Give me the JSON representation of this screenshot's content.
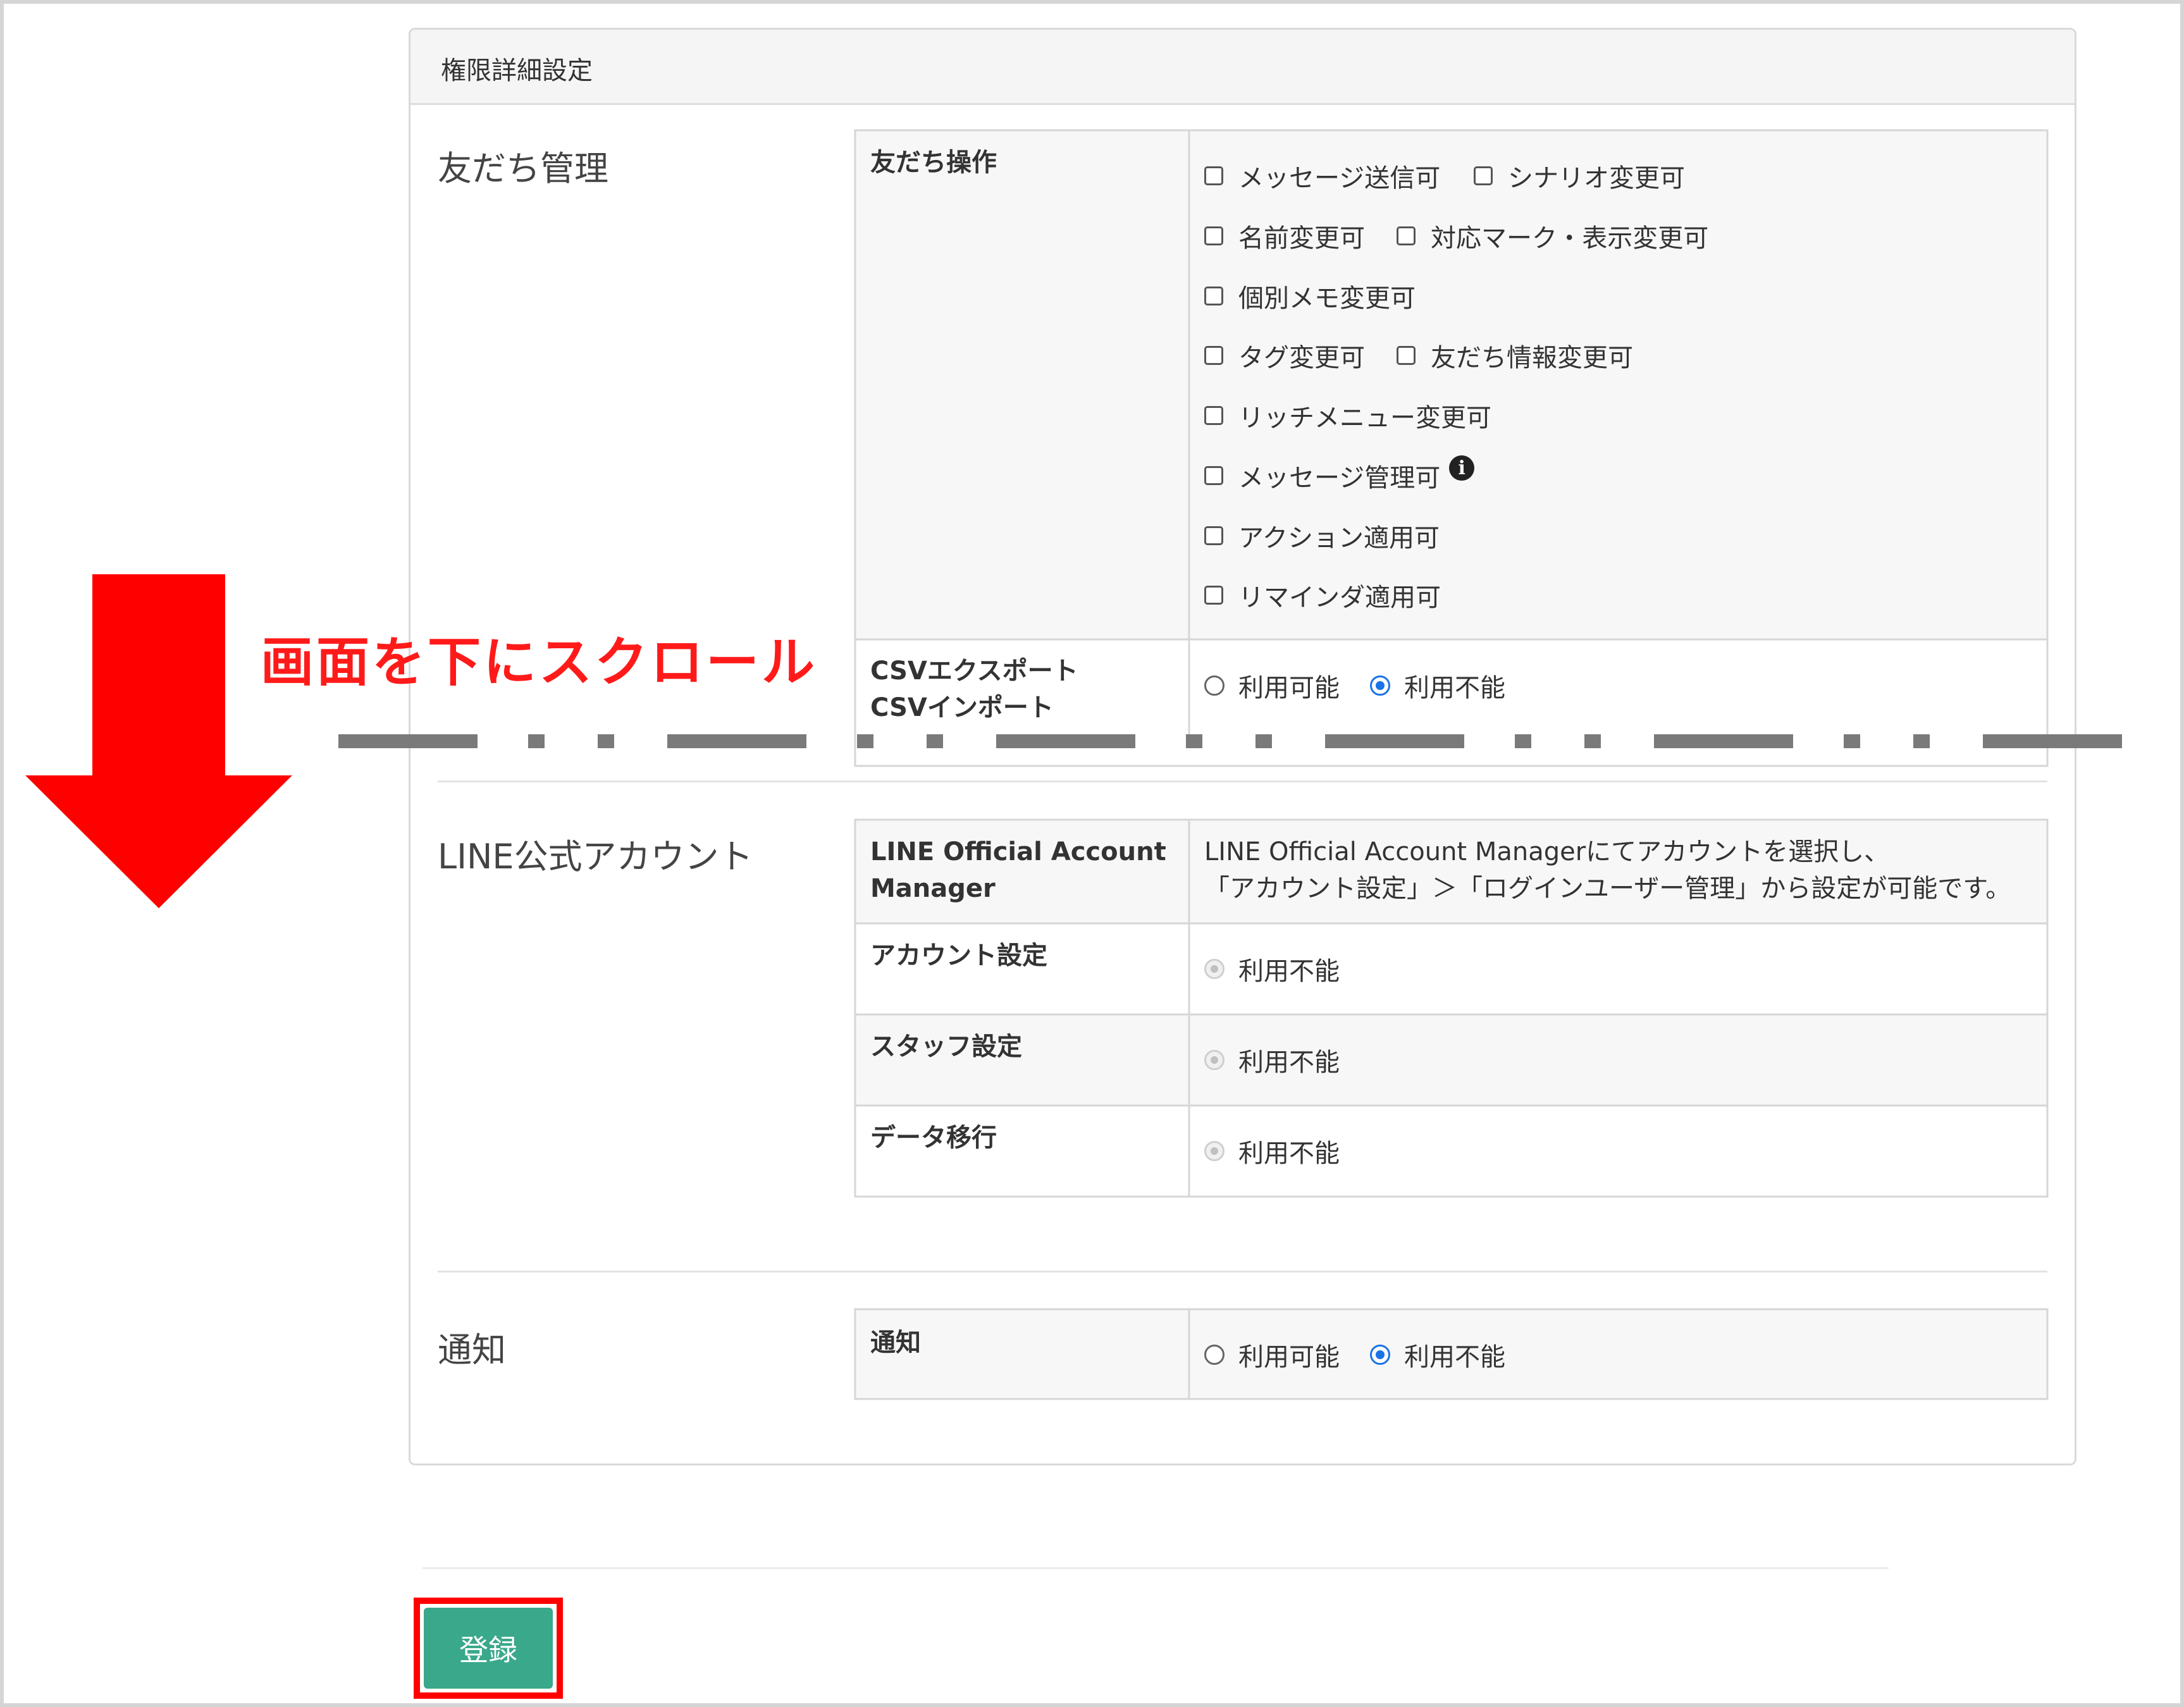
{
  "panel": {
    "title": "権限詳細設定"
  },
  "sections": {
    "friends": {
      "title": "友だち管理",
      "friend_ops": {
        "label": "友だち操作",
        "options": [
          "メッセージ送信可",
          "シナリオ変更可",
          "名前変更可",
          "対応マーク・表示変更可",
          "個別メモ変更可",
          "タグ変更可",
          "友だち情報変更可",
          "リッチメニュー変更可",
          "メッセージ管理可",
          "アクション適用可",
          "リマインダ適用可"
        ],
        "info_icon": "info-circle-icon"
      },
      "csv": {
        "label_line1": "CSVエクスポート",
        "label_line2": "CSVインポート",
        "options": [
          "利用可能",
          "利用不能"
        ],
        "selected": "利用不能"
      }
    },
    "line_account": {
      "title": "LINE公式アカウント",
      "manager": {
        "label_line1": "LINE Official Account",
        "label_line2": "Manager",
        "desc_line1": "LINE Official Account Managerにてアカウントを選択し、",
        "desc_line2": "「アカウント設定」＞「ログインユーザー管理」から設定が可能です。"
      },
      "account_settings": {
        "label": "アカウント設定",
        "option": "利用不能"
      },
      "staff_settings": {
        "label": "スタッフ設定",
        "option": "利用不能"
      },
      "data_migration": {
        "label": "データ移行",
        "option": "利用不能"
      }
    },
    "notification": {
      "title": "通知",
      "label": "通知",
      "options": [
        "利用可能",
        "利用不能"
      ],
      "selected": "利用不能"
    }
  },
  "annotation": {
    "text": "画面を下にスクロール",
    "color": "#ff0000",
    "arrow_icon": "down-arrow-icon"
  },
  "submit": {
    "label": "登録",
    "color": "#3aa88b",
    "highlight_color": "#ff0000"
  }
}
